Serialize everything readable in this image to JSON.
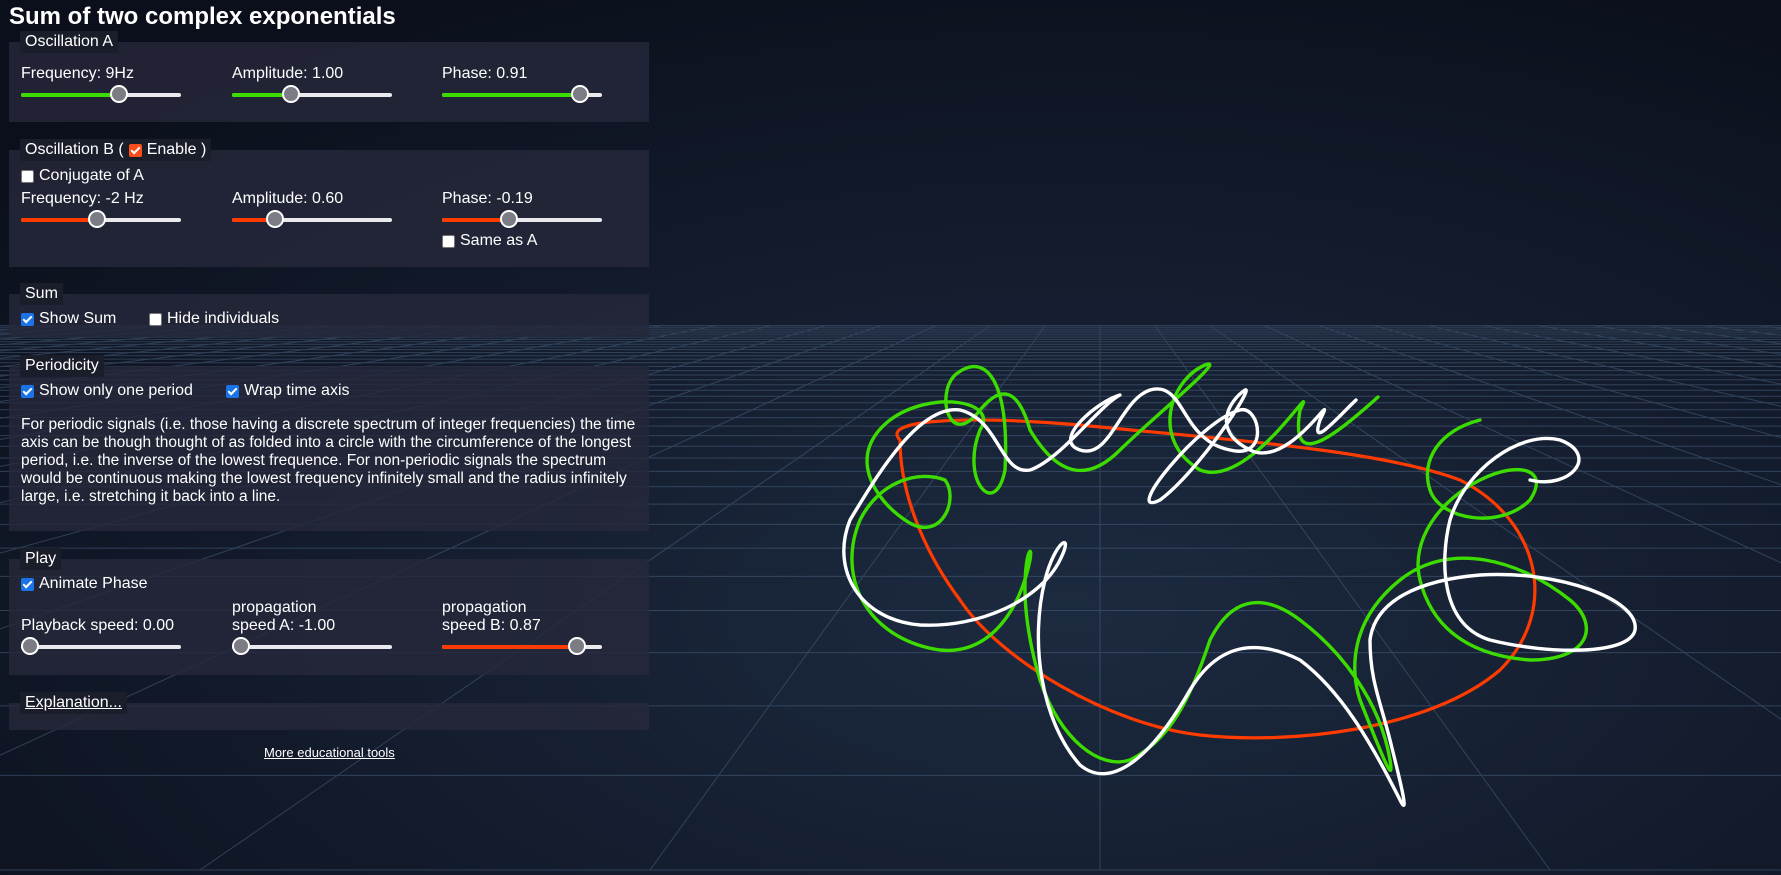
{
  "app": {
    "title": "Sum of two complex exponentials"
  },
  "colors": {
    "oscA": "#3ddc00",
    "oscB": "#ff3b00",
    "sum": "#ffffff",
    "background": "#0d1220",
    "grid": "#4a6280"
  },
  "oscA": {
    "legend": "Oscillation A",
    "frequency": {
      "label": "Frequency: 9Hz",
      "level": 0.63
    },
    "amplitude": {
      "label": "Amplitude: 1.00",
      "level": 0.35
    },
    "phase": {
      "label": "Phase: 0.91",
      "level": 0.91
    }
  },
  "oscB": {
    "legend_prefix": "Oscillation B (",
    "enable_label": "Enable )",
    "enable_checked": true,
    "conjugate_label": "Conjugate of A",
    "conjugate_checked": false,
    "frequency": {
      "label": "Frequency: -2 Hz",
      "level": 0.47
    },
    "amplitude": {
      "label": "Amplitude: 0.60",
      "level": 0.24
    },
    "phase": {
      "label": "Phase: -0.19",
      "level": 0.41
    },
    "same_as_a_label": "Same as A",
    "same_as_a_checked": false
  },
  "sum": {
    "legend": "Sum",
    "show_sum_label": "Show Sum",
    "show_sum_checked": true,
    "hide_individuals_label": "Hide individuals",
    "hide_individuals_checked": false
  },
  "periodicity": {
    "legend": "Periodicity",
    "one_period_label": "Show only one period",
    "one_period_checked": true,
    "wrap_label": "Wrap time axis",
    "wrap_checked": true,
    "text": "For periodic signals (i.e. those having a discrete spectrum of integer frequencies) the time axis can be though thought of as folded into a circle with the circumference of the longest period, i.e. the inverse of the lowest frequence. For non-periodic signals the spectrum would be continuous making the lowest frequency infinitely small and the radius infinitely large, i.e. stretching it back into a line."
  },
  "play": {
    "legend": "Play",
    "animate_label": "Animate Phase",
    "animate_checked": true,
    "playback": {
      "label": "Playback speed: 0.00",
      "level": 0.0
    },
    "prop_a": {
      "label_line1": "propagation",
      "label_line2": "speed A: -1.00",
      "level": 0.0
    },
    "prop_b": {
      "label_line1": "propagation",
      "label_line2": "speed B: 0.87",
      "level": 0.89
    }
  },
  "explanation": {
    "link": "Explanation..."
  },
  "footer": {
    "more_tools": "More educational tools"
  }
}
